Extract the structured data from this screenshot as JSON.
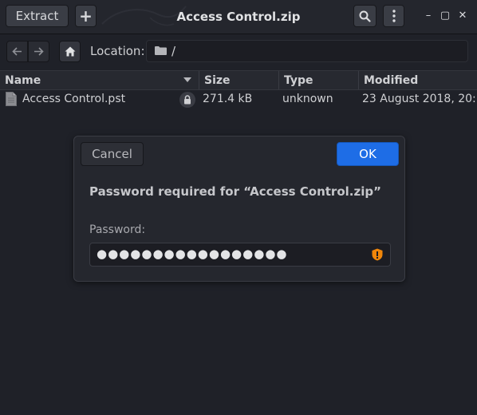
{
  "window": {
    "title": "Access Control.zip",
    "extract_label": "Extract",
    "add_glyph": "+",
    "minimize_glyph": "–",
    "maximize_glyph": "▢",
    "close_glyph": "✕"
  },
  "location": {
    "label": "Location:",
    "path": "/"
  },
  "columns": {
    "name": "Name",
    "size": "Size",
    "type": "Type",
    "modified": "Modified"
  },
  "files": [
    {
      "name": "Access Control.pst",
      "size": "271.4 kB",
      "type": "unknown",
      "modified": "23 August 2018, 20:…"
    }
  ],
  "dialog": {
    "cancel_label": "Cancel",
    "ok_label": "OK",
    "prompt": "Password required for “Access Control.zip”",
    "password_label": "Password:",
    "password_value": "●●●●●●●●●●●●●●●●●"
  },
  "colors": {
    "accent": "#1e6de6",
    "warning": "#f0860a"
  }
}
